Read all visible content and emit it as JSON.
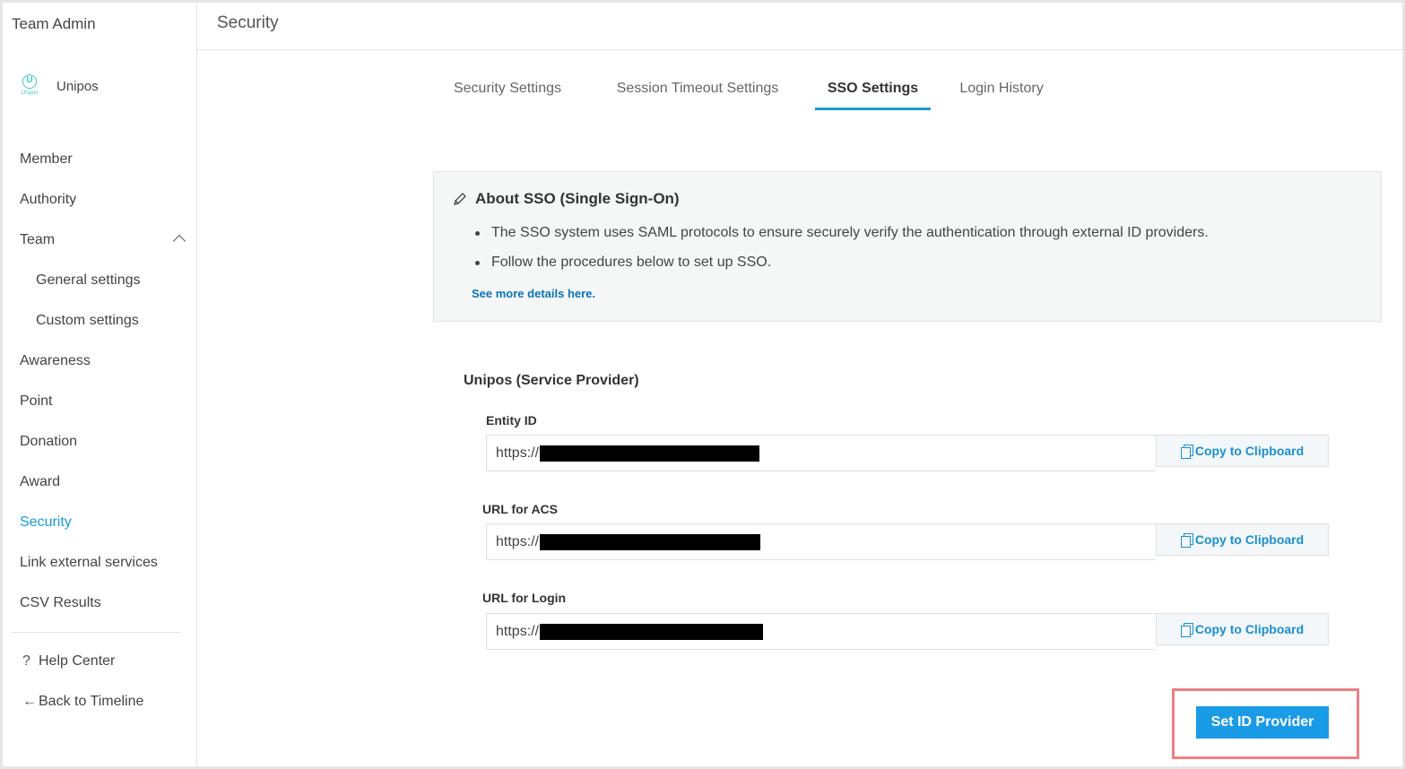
{
  "sidebar": {
    "title": "Team Admin",
    "org_name": "Unipos",
    "logo_text": "Unipos",
    "logo_letter": "U",
    "items": [
      {
        "label": "Member"
      },
      {
        "label": "Authority"
      },
      {
        "label": "Team"
      },
      {
        "label": "General settings"
      },
      {
        "label": "Custom settings"
      },
      {
        "label": "Awareness"
      },
      {
        "label": "Point"
      },
      {
        "label": "Donation"
      },
      {
        "label": "Award"
      },
      {
        "label": "Security"
      },
      {
        "label": "Link external services"
      },
      {
        "label": "CSV Results"
      }
    ],
    "bottom": [
      {
        "label": "Help Center",
        "glyph": "?"
      },
      {
        "label": "Back to Timeline",
        "glyph": "←"
      }
    ]
  },
  "header": {
    "title": "Security"
  },
  "tabs": [
    {
      "label": "Security Settings"
    },
    {
      "label": "Session Timeout Settings"
    },
    {
      "label": "SSO Settings"
    },
    {
      "label": "Login History"
    }
  ],
  "info": {
    "title": "About SSO (Single Sign-On)",
    "bullets": [
      "The SSO system uses SAML protocols to ensure securely verify the authentication through external ID providers.",
      "Follow the procedures below to set up SSO."
    ],
    "link": "See more details here."
  },
  "service_provider": {
    "title": "Unipos (Service Provider)",
    "fields": [
      {
        "label": "Entity ID",
        "value_prefix": "https://",
        "copy_label": "Copy to Clipboard"
      },
      {
        "label": "URL for ACS",
        "value_prefix": "https://",
        "copy_label": "Copy to Clipboard"
      },
      {
        "label": "URL for Login",
        "value_prefix": "https://",
        "copy_label": "Copy to Clipboard"
      }
    ]
  },
  "primary_button": {
    "label": "Set ID Provider"
  },
  "colors": {
    "accent": "#1a9bd7",
    "button": "#1a9be6",
    "highlight": "#ee7f84"
  }
}
